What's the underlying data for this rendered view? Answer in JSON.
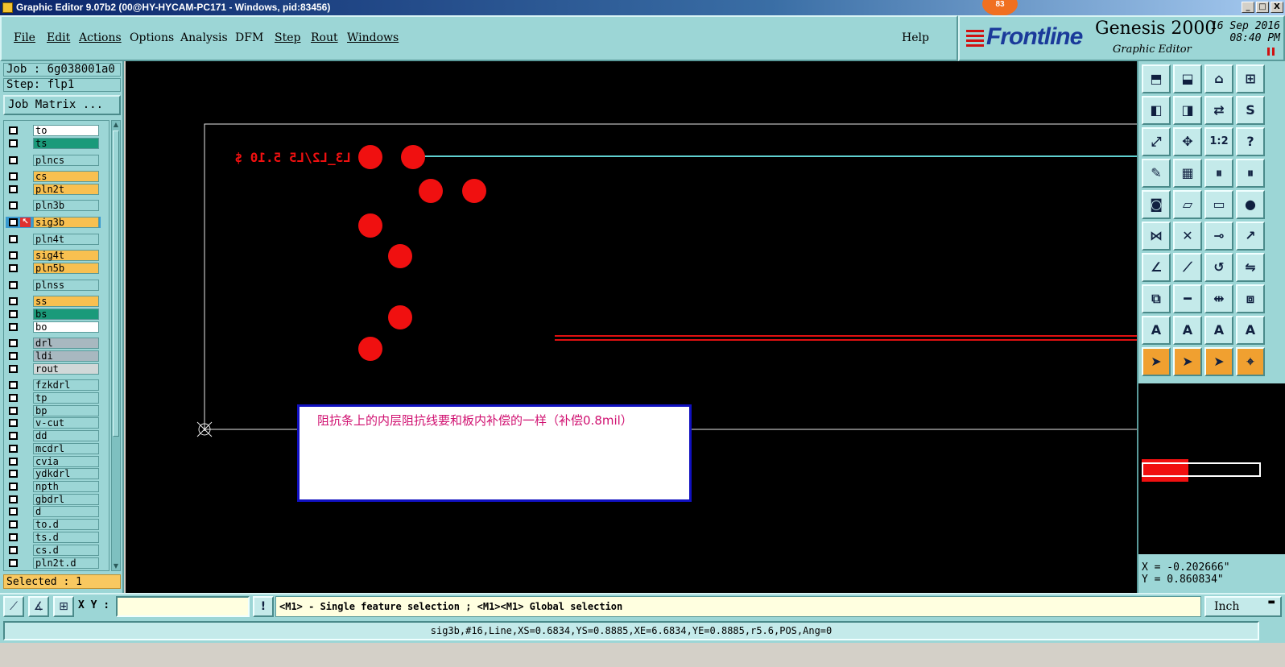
{
  "window": {
    "title": "Graphic Editor 9.07b2 (00@HY-HYCAM-PC171 - Windows, pid:83456)",
    "badge": "83",
    "controls": [
      "_",
      "□",
      "X"
    ]
  },
  "menu": {
    "items": [
      {
        "label": "File",
        "underline": true
      },
      {
        "label": "Edit",
        "underline": true
      },
      {
        "label": "Actions",
        "underline": true
      },
      {
        "label": "Options",
        "underline": false
      },
      {
        "label": "Analysis",
        "underline": false
      },
      {
        "label": "DFM",
        "underline": false
      },
      {
        "label": "Step",
        "underline": true
      },
      {
        "label": "Rout",
        "underline": true
      },
      {
        "label": "Windows",
        "underline": true
      }
    ],
    "help": "Help"
  },
  "brand": {
    "logo": "Frontline",
    "product": "Genesis 2000",
    "subtitle": "Graphic Editor",
    "date": "16 Sep 2016",
    "time": "08:40 PM"
  },
  "job": {
    "job_line": "Job : 6g038001a0",
    "step_line": "Step: flp1",
    "matrix_button": "Job Matrix ...",
    "selected": "Selected : 1"
  },
  "layers": [
    {
      "name": "to",
      "color": "#ffffff"
    },
    {
      "name": "ts",
      "color": "#1a9a7a"
    },
    {
      "name": "plncs",
      "color": "#9cd6d6"
    },
    {
      "name": "cs",
      "color": "#f8c050"
    },
    {
      "name": "pln2t",
      "color": "#f8c050"
    },
    {
      "name": "pln3b",
      "color": "#9cd6d6"
    },
    {
      "name": "sig3b",
      "color": "#f8c050",
      "active": true
    },
    {
      "name": "pln4t",
      "color": "#9cd6d6"
    },
    {
      "name": "sig4t",
      "color": "#f8c050"
    },
    {
      "name": "pln5b",
      "color": "#f8c050"
    },
    {
      "name": "plnss",
      "color": "#9cd6d6"
    },
    {
      "name": "ss",
      "color": "#f8c050"
    },
    {
      "name": "bs",
      "color": "#1a9a7a"
    },
    {
      "name": "bo",
      "color": "#ffffff"
    },
    {
      "name": "drl",
      "color": "#a8b8c0"
    },
    {
      "name": "ldi",
      "color": "#a8b8c0"
    },
    {
      "name": "rout",
      "color": "#d0d8d8"
    },
    {
      "name": "fzkdrl",
      "color": "#9cd6d6"
    },
    {
      "name": "tp",
      "color": "#9cd6d6"
    },
    {
      "name": "bp",
      "color": "#9cd6d6"
    },
    {
      "name": "v-cut",
      "color": "#9cd6d6"
    },
    {
      "name": "dd",
      "color": "#9cd6d6"
    },
    {
      "name": "mcdrl",
      "color": "#9cd6d6"
    },
    {
      "name": "cvia",
      "color": "#9cd6d6"
    },
    {
      "name": "ydkdrl",
      "color": "#9cd6d6"
    },
    {
      "name": "npth",
      "color": "#9cd6d6"
    },
    {
      "name": "gbdrl",
      "color": "#9cd6d6"
    },
    {
      "name": "d",
      "color": "#9cd6d6"
    },
    {
      "name": "to.d",
      "color": "#9cd6d6"
    },
    {
      "name": "ts.d",
      "color": "#9cd6d6"
    },
    {
      "name": "cs.d",
      "color": "#9cd6d6"
    },
    {
      "name": "pln2t.d",
      "color": "#9cd6d6"
    }
  ],
  "canvas": {
    "mirror_text": "L3_L2/L5 5.10 $",
    "note": "阻抗条上的内层阻抗线要和板内补偿的一样（补偿0.8mil）",
    "pad_color": "#f01010",
    "line_color": "#60d0d0"
  },
  "tools": [
    {
      "name": "pan-up-icon",
      "glyph": "⬒"
    },
    {
      "name": "pan-down-icon",
      "glyph": "⬓"
    },
    {
      "name": "home-icon",
      "glyph": "⌂"
    },
    {
      "name": "grid-window-icon",
      "glyph": "⊞"
    },
    {
      "name": "pan-left-icon",
      "glyph": "◧"
    },
    {
      "name": "pan-right-icon",
      "glyph": "◨"
    },
    {
      "name": "swap-icon",
      "glyph": "⇄"
    },
    {
      "name": "snap-icon",
      "glyph": "S"
    },
    {
      "name": "zoom-fit-icon",
      "glyph": "⤢"
    },
    {
      "name": "zoom-center-icon",
      "glyph": "✥"
    },
    {
      "name": "scale-1-2-icon",
      "glyph": "1:2"
    },
    {
      "name": "help-icon",
      "glyph": "?"
    },
    {
      "name": "measure-icon",
      "glyph": "✎"
    },
    {
      "name": "grid-icon",
      "glyph": "▦"
    },
    {
      "name": "layer-toggle-icon",
      "glyph": "⏸"
    },
    {
      "name": "layer-toggle-2-icon",
      "glyph": "⏸"
    },
    {
      "name": "add-pad-icon",
      "glyph": "◙"
    },
    {
      "name": "add-surface-icon",
      "glyph": "▱"
    },
    {
      "name": "ruler-icon",
      "glyph": "▭"
    },
    {
      "name": "circle-icon",
      "glyph": "●"
    },
    {
      "name": "connect-icon",
      "glyph": "⋈"
    },
    {
      "name": "delete-icon",
      "glyph": "✕"
    },
    {
      "name": "node-icon",
      "glyph": "⊸"
    },
    {
      "name": "move-node-icon",
      "glyph": "↗"
    },
    {
      "name": "line-angle-icon",
      "glyph": "∠"
    },
    {
      "name": "slant-line-icon",
      "glyph": "⟋"
    },
    {
      "name": "arc-icon",
      "glyph": "↺"
    },
    {
      "name": "mirror-icon",
      "glyph": "⇋"
    },
    {
      "name": "copy-node-icon",
      "glyph": "⧉"
    },
    {
      "name": "segment-icon",
      "glyph": "━"
    },
    {
      "name": "dimension-icon",
      "glyph": "⇹"
    },
    {
      "name": "group-icon",
      "glyph": "⧈"
    },
    {
      "name": "text-a-icon",
      "glyph": "A"
    },
    {
      "name": "text-a-2-icon",
      "glyph": "A"
    },
    {
      "name": "text-a-3-icon",
      "glyph": "A"
    },
    {
      "name": "text-a-4-icon",
      "glyph": "A"
    },
    {
      "name": "select-pointer-icon",
      "glyph": "➤",
      "state": "active"
    },
    {
      "name": "select-pointer-2-icon",
      "glyph": "➤",
      "state": "orange"
    },
    {
      "name": "select-pointer-3-icon",
      "glyph": "➤",
      "state": "orange"
    },
    {
      "name": "route-select-icon",
      "glyph": "⌖",
      "state": "orange"
    }
  ],
  "coords": {
    "x": "X = -0.202666\"",
    "y": "Y = 0.860834\""
  },
  "bottom": {
    "xy_label": "X Y :",
    "xy_value": "",
    "hint": "<M1> - Single feature selection ; <M1><M1> Global selection",
    "unit": "Inch",
    "status": "sig3b,#16,Line,XS=0.6834,YS=0.8885,XE=6.6834,YE=0.8885,r5.6,POS,Ang=0"
  }
}
